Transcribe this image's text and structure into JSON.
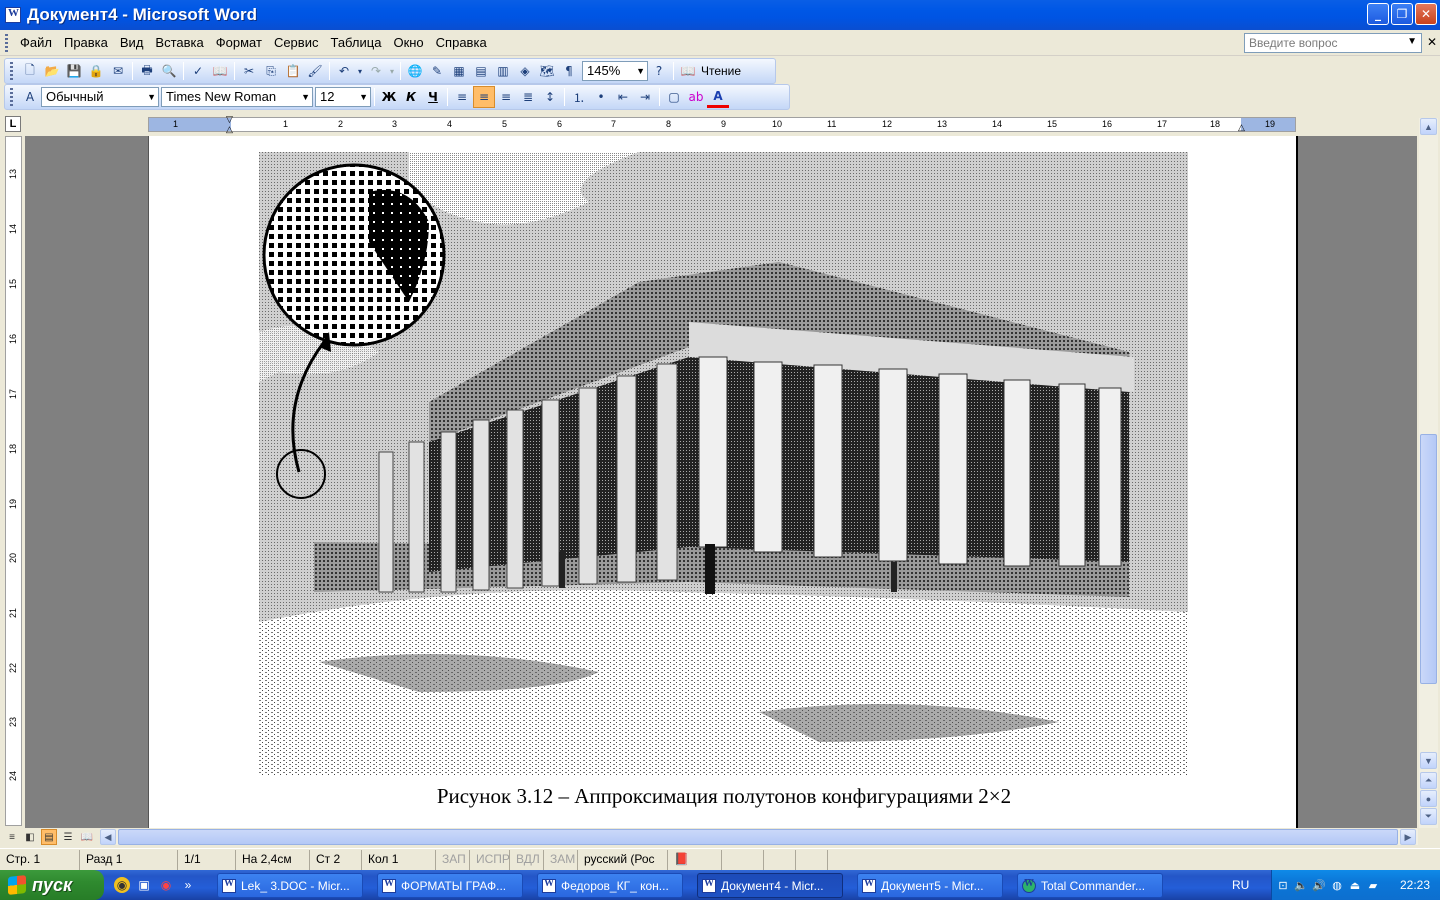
{
  "window": {
    "title": "Документ4 - Microsoft Word"
  },
  "menu": {
    "items": [
      "Файл",
      "Правка",
      "Вид",
      "Вставка",
      "Формат",
      "Сервис",
      "Таблица",
      "Окно",
      "Справка"
    ],
    "help_placeholder": "Введите вопрос"
  },
  "standard_toolbar": {
    "zoom": "145%",
    "reading_label": "Чтение"
  },
  "formatting_toolbar": {
    "style": "Обычный",
    "font": "Times New Roman",
    "size": "12",
    "bold": "Ж",
    "italic": "К",
    "underline": "Ч",
    "font_color_label": "A"
  },
  "ruler": {
    "tab_selector": "L",
    "numbers": [
      "1",
      "1",
      "2",
      "3",
      "4",
      "5",
      "6",
      "7",
      "8",
      "9",
      "10",
      "11",
      "12",
      "13",
      "14",
      "15",
      "16",
      "17",
      "18",
      "19"
    ],
    "vertical_numbers": [
      "13",
      "14",
      "15",
      "16",
      "17",
      "18",
      "19",
      "20",
      "21",
      "22",
      "23",
      "24"
    ]
  },
  "document": {
    "caption": "Рисунок 3.12 – Аппроксимация полутонов  конфигурациями 2×2"
  },
  "statusbar": {
    "page": "Стр. 1",
    "section": "Разд 1",
    "pages": "1/1",
    "at": "На 2,4см",
    "line": "Ст 2",
    "col": "Кол 1",
    "rec": "ЗАП",
    "trk": "ИСПР",
    "ext": "ВДЛ",
    "ovr": "ЗАМ",
    "language": "русский (Рос"
  },
  "taskbar": {
    "start_label": "пуск",
    "tasks": [
      {
        "label": "Lek_ 3.DOC - Micr..."
      },
      {
        "label": "ФОРМАТЫ ГРАФ..."
      },
      {
        "label": "Федоров_КГ_ кон..."
      },
      {
        "label": "Документ4 - Micr..."
      },
      {
        "label": "Документ5 - Micr..."
      },
      {
        "label": "Total Commander..."
      }
    ],
    "language": "RU",
    "clock": "22:23"
  },
  "colors": {
    "title_blue": "#0054e3",
    "taskbar_blue": "#245ed8",
    "start_green": "#2f8a2f"
  }
}
